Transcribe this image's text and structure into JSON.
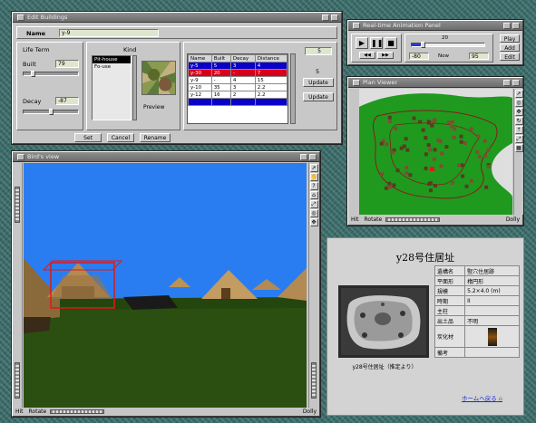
{
  "edit_window": {
    "title": "Edit Buildings",
    "name_label": "Name",
    "name_value": "y-9",
    "life_label": "Life Term",
    "built_label": "Built",
    "built_value": "79",
    "decay_label": "Decay",
    "decay_value": "-87",
    "kind_label": "Kind",
    "kind_items": [
      "Pit-house",
      "Fo-use"
    ],
    "preview_label": "Preview",
    "buttons": [
      "Set",
      "Cancel",
      "Rename"
    ],
    "side_values": [
      "5",
      "5"
    ],
    "side_buttons": [
      "Update",
      "Update"
    ],
    "table": {
      "headers": [
        "Name",
        "Built",
        "Decay",
        "Distance"
      ],
      "rows": [
        [
          "y-5",
          "5",
          "3",
          "4"
        ],
        [
          "y-30",
          "20",
          "-",
          "7"
        ],
        [
          "y-9",
          "-",
          "4",
          "15"
        ],
        [
          "y-10",
          "35",
          "3",
          "2.2"
        ],
        [
          "y-12",
          "16",
          "2",
          "2.2"
        ],
        [
          "",
          "",
          "",
          ""
        ]
      ]
    }
  },
  "time_window": {
    "title": "Real-time Animation Panel",
    "year_value": "20",
    "left_value": "-80",
    "right_value": "95",
    "center_label": "Now",
    "side_buttons": [
      "Play",
      "Add",
      "Edit"
    ]
  },
  "map_window": {
    "title": "Plan Viewer",
    "status_left": "Hit",
    "status_rotate": "Rotate",
    "status_right": "Dolly"
  },
  "view_window": {
    "title": "Bird's view",
    "status_left": "Hit",
    "status_rotate": "Rotate",
    "status_right": "Dolly"
  },
  "info": {
    "title": "y28号住居址",
    "caption": "y28号住居址（推定より）",
    "labels": [
      "遺構名",
      "平面形",
      "規模",
      "時期",
      "主柱",
      "出土品",
      "炭化材",
      "備考"
    ],
    "values": [
      "竪穴住居跡",
      "楕円形",
      "5.2×4.0 (m)",
      "II",
      "",
      "不明",
      "",
      ""
    ],
    "link_text": "ホームへ戻る",
    "link_icon": "home-icon"
  },
  "colors": {
    "sky": "#2a7df0",
    "ground": "#2a4f10",
    "map_green": "#1f9a1f",
    "table_blue": "#0a00c8",
    "table_red": "#d80018"
  }
}
